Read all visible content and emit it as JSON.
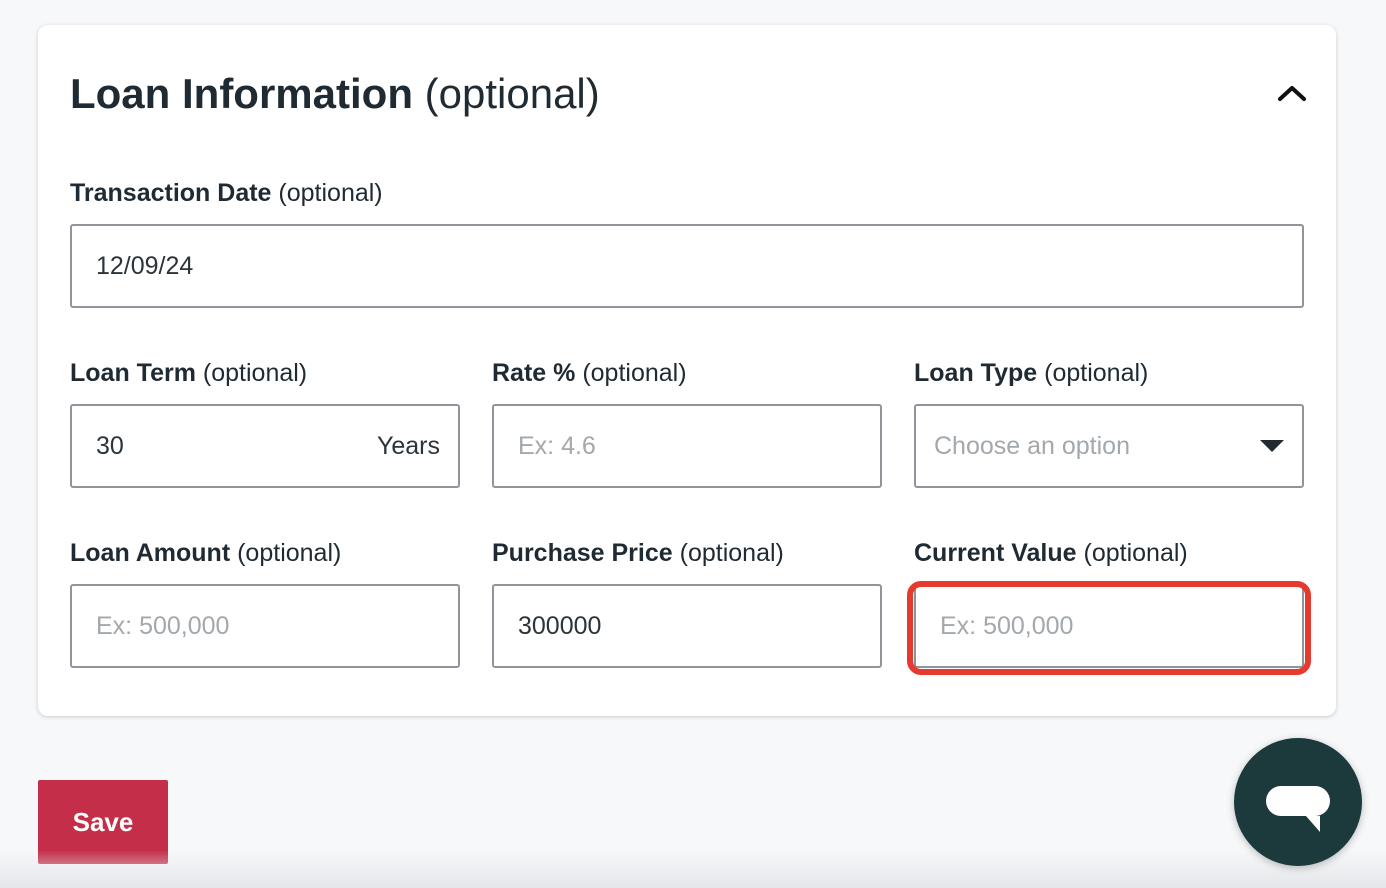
{
  "section": {
    "title": "Loan Information",
    "title_optional": "(optional)",
    "collapse_icon": "chevron-up-icon"
  },
  "fields": {
    "transaction_date": {
      "label": "Transaction Date",
      "optional": "(optional)",
      "value": "12/09/24"
    },
    "loan_term": {
      "label": "Loan Term",
      "optional": "(optional)",
      "value": "30",
      "suffix": "Years"
    },
    "rate": {
      "label": "Rate %",
      "optional": "(optional)",
      "value": "",
      "placeholder": "Ex: 4.6"
    },
    "loan_type": {
      "label": "Loan Type",
      "optional": "(optional)",
      "selected": "Choose an option"
    },
    "loan_amount": {
      "label": "Loan Amount",
      "optional": "(optional)",
      "value": "",
      "placeholder": "Ex: 500,000"
    },
    "purchase_price": {
      "label": "Purchase Price",
      "optional": "(optional)",
      "value": "300000"
    },
    "current_value": {
      "label": "Current Value",
      "optional": "(optional)",
      "value": "",
      "placeholder": "Ex: 500,000"
    }
  },
  "actions": {
    "save_label": "Save"
  },
  "chat": {
    "icon": "chat-bubble-icon"
  },
  "colors": {
    "primary_button": "#c42e48",
    "highlight": "#e53a2d",
    "chat_button": "#1c3a3c"
  }
}
